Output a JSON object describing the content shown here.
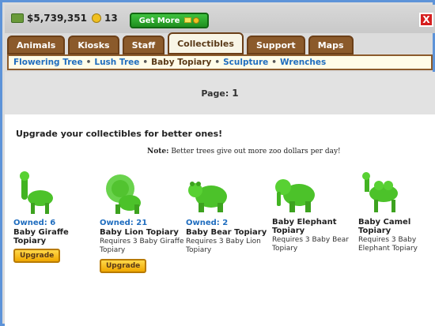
{
  "header": {
    "money": "$5,739,351",
    "coins": "13",
    "get_more_label": "Get More",
    "close_label": "X"
  },
  "tabs": [
    {
      "label": "Animals"
    },
    {
      "label": "Kiosks"
    },
    {
      "label": "Staff"
    },
    {
      "label": "Collectibles",
      "active": true
    },
    {
      "label": "Support"
    },
    {
      "label": "Maps"
    }
  ],
  "subnav": {
    "items": [
      {
        "label": "Flowering Tree"
      },
      {
        "label": "Lush Tree"
      },
      {
        "label": "Baby Topiary",
        "current": true
      },
      {
        "label": "Sculpture"
      },
      {
        "label": "Wrenches"
      }
    ],
    "separator": "•"
  },
  "page": {
    "label": "Page:",
    "number": "1"
  },
  "content": {
    "upgrade_heading": "Upgrade your collectibles for better ones!",
    "note_label": "Note:",
    "note_text": "Better trees give out more zoo dollars per day!",
    "items": [
      {
        "owned": "Owned: 6",
        "name": "Baby Giraffe Topiary",
        "requires": "",
        "upgrade": "Upgrade"
      },
      {
        "owned": "Owned: 21",
        "name": "Baby Lion Topiary",
        "requires": "Requires 3 Baby Giraffe Topiary",
        "upgrade": "Upgrade"
      },
      {
        "owned": "Owned: 2",
        "name": "Baby Bear Topiary",
        "requires": "Requires 3 Baby Lion Topiary",
        "upgrade": ""
      },
      {
        "owned": "",
        "name": "Baby Elephant Topiary",
        "requires": "Requires 3 Baby Bear Topiary",
        "upgrade": ""
      },
      {
        "owned": "",
        "name": "Baby Camel Topiary",
        "requires": "Requires 3 Baby Elephant Topiary",
        "upgrade": ""
      }
    ]
  },
  "colors": {
    "link": "#1f6dbf",
    "tab": "#8b5a2b",
    "topiary_green": "#4cc22a",
    "get_more_green": "#2aa12a",
    "close_red": "#d61f1f"
  }
}
